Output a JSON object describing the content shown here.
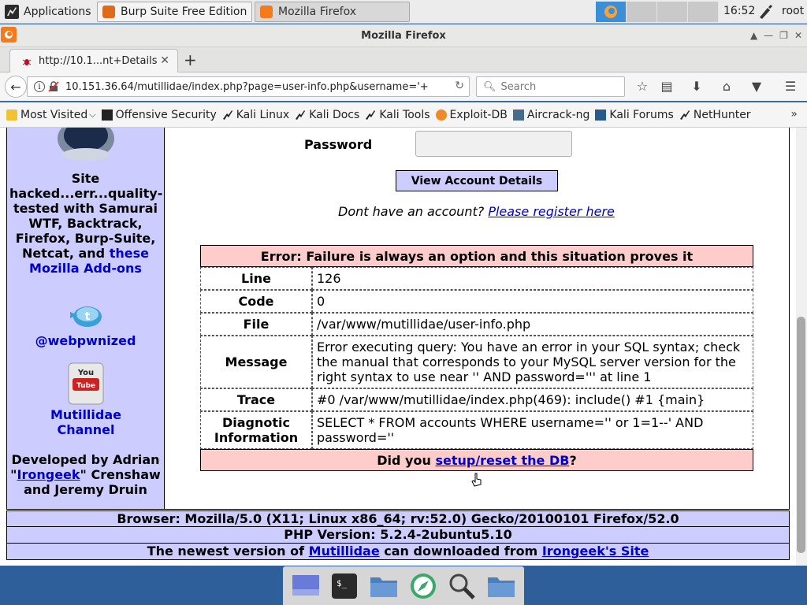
{
  "panel": {
    "applications_label": "Applications",
    "task_burp": "Burp Suite Free Edition ...",
    "task_firefox": "Mozilla Firefox",
    "clock": "16:52",
    "user": "root"
  },
  "browser": {
    "window_title": "Mozilla Firefox",
    "tab_title": "http://10.1...nt+Details",
    "url": "10.151.36.64/mutillidae/index.php?page=user-info.php&username='+",
    "search_placeholder": "Search",
    "bookmarks": [
      "Most Visited",
      "Offensive Security",
      "Kali Linux",
      "Kali Docs",
      "Kali Tools",
      "Exploit-DB",
      "Aircrack-ng",
      "Kali Forums",
      "NetHunter"
    ]
  },
  "sidebar": {
    "hacked_text": "Site hacked...err...quality-tested with Samurai WTF, Backtrack, Firefox, Burp-Suite, Netcat, and",
    "addons_link": "these Mozilla Add-ons",
    "twitter_handle": "@webpwnized",
    "channel_link": "Mutillidae Channel",
    "developed_prefix": "Developed by Adrian \"",
    "irongeek_link": "Irongeek",
    "developed_suffix": "\" Crenshaw and Jeremy Druin"
  },
  "form": {
    "password_label": "Password",
    "password_value": "",
    "view_button": "View Account Details",
    "register_prefix": "Dont have an account?",
    "register_link": "Please register here"
  },
  "error": {
    "header": "Error: Failure is always an option and this situation proves it",
    "rows": [
      {
        "label": "Line",
        "value": "126"
      },
      {
        "label": "Code",
        "value": "0"
      },
      {
        "label": "File",
        "value": "/var/www/mutillidae/user-info.php"
      },
      {
        "label": "Message",
        "value": "Error executing query: You have an error in your SQL syntax; check the manual that corresponds to your MySQL server version for the right syntax to use near '' AND password=''' at line 1"
      },
      {
        "label": "Trace",
        "value": "#0 /var/www/mutillidae/index.php(469): include() #1 {main}"
      },
      {
        "label": "Diagnotic Information",
        "value": "SELECT * FROM accounts WHERE username='' or 1=1--' AND password=''"
      }
    ],
    "footer_prefix": "Did you",
    "footer_link": "setup/reset the DB",
    "footer_suffix": "?"
  },
  "footer": {
    "browser_info": "Browser: Mozilla/5.0 (X11; Linux x86_64; rv:52.0) Gecko/20100101 Firefox/52.0",
    "php_version": "PHP Version: 5.2.4-2ubuntu5.10",
    "newest_prefix": "The newest version of",
    "mutillidae_link": "Mutillidae",
    "newest_middle": "can downloaded from",
    "irongeek_site_link": "Irongeek's Site"
  },
  "colors": {
    "sidebar_bg": "#ccccff",
    "error_header_bg": "#ffcccc",
    "link": "#0000cc",
    "desktop_bg": "#3b6ea5"
  }
}
